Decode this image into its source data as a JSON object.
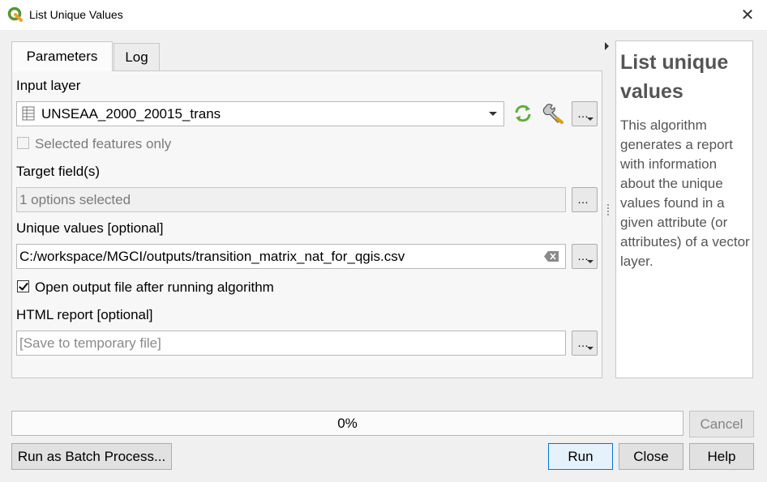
{
  "window": {
    "title": "List Unique Values",
    "app_icon": "qgis-icon",
    "close_icon": "close-icon"
  },
  "tabs": [
    {
      "label": "Parameters",
      "active": true
    },
    {
      "label": "Log",
      "active": false
    }
  ],
  "form": {
    "input_layer": {
      "label": "Input layer",
      "value": "UNSEAA_2000_20015_trans",
      "layer_icon": "table-layer-icon"
    },
    "selected_only": {
      "label": "Selected features only",
      "checked": false,
      "enabled": false
    },
    "target_fields": {
      "label": "Target field(s)",
      "value": "1 options selected"
    },
    "unique_values": {
      "label": "Unique values [optional]",
      "value": "C:/workspace/MGCI/outputs/transition_matrix_nat_for_qgis.csv"
    },
    "open_output": {
      "label": "Open output file after running algorithm",
      "checked": true
    },
    "html_report": {
      "label": "HTML report [optional]",
      "placeholder": "[Save to temporary file]"
    },
    "ellipsis": "…"
  },
  "help": {
    "title": "List unique values",
    "body": "This algorithm generates a report with information about the unique values found in a given attribute (or attributes) of a vector layer."
  },
  "progress": {
    "value": 0,
    "label": "0%"
  },
  "buttons": {
    "cancel": "Cancel",
    "batch": "Run as Batch Process...",
    "run": "Run",
    "close": "Close",
    "help": "Help"
  },
  "colors": {
    "qgis_green": "#589632",
    "qgis_yellow": "#ee9f2a",
    "refresh_green": "#5fae3a",
    "default_button_border": "#0078d7"
  }
}
